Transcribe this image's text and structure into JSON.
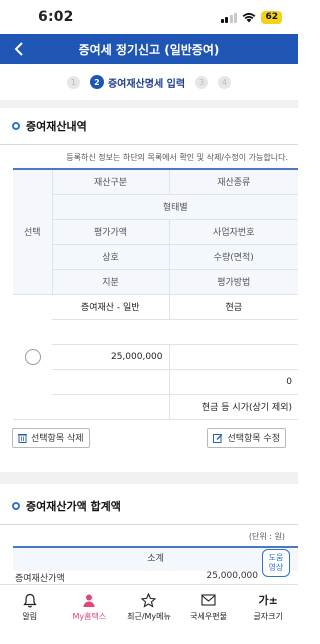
{
  "status": {
    "time": "6:02",
    "battery": "62"
  },
  "header": {
    "title": "증여세 정기신고 (일반증여)"
  },
  "steps": {
    "prev": "1",
    "active_num": "2",
    "active_label": "증여재산명세 입력",
    "next1": "3",
    "next2": "4"
  },
  "section1": {
    "title": "증여재산내역",
    "notice": "등록하신 정보는 하단의 목록에서 확인 및 삭제/수정이 가능합니다."
  },
  "table": {
    "select_label": "선택",
    "headers": {
      "asset_category": "재산구분",
      "asset_type": "재산종류",
      "form": "형태별",
      "appraised_value": "평가가액",
      "business_number": "사업자번호",
      "trade_name": "상호",
      "quantity": "수량(면적)",
      "share": "지분",
      "valuation_method": "평가방법"
    },
    "row": {
      "asset_category": "증여재산 - 일반",
      "asset_type": "현금",
      "appraised_value": "25,000,000",
      "quantity": "0",
      "valuation_method": "현금 등 시가(상기 제외)"
    }
  },
  "actions": {
    "delete_label": "선택항목 삭제",
    "edit_label": "선택항목 수정"
  },
  "section2": {
    "title": "증여재산가액 합계액",
    "unit": "(단위 : 원)",
    "subtotal": "소계",
    "row_label": "증여재산가액",
    "row_value": "25,000,000"
  },
  "help": {
    "line1": "도움",
    "line2": "영상"
  },
  "nav": {
    "items": [
      {
        "label": "알림"
      },
      {
        "label": "My홈택스"
      },
      {
        "label": "최근/My메뉴"
      },
      {
        "label": "국세우편물"
      },
      {
        "label": "글자크기"
      }
    ],
    "font_size_glyph": "가±"
  },
  "colors": {
    "header": "#1f55b4",
    "active_nav": "#e0457b",
    "accent": "#2c73d2"
  }
}
